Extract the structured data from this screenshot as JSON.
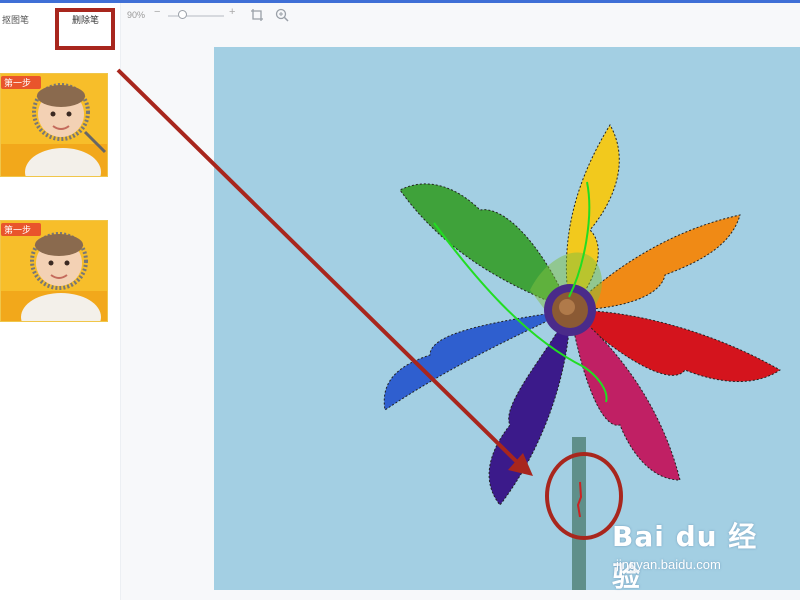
{
  "toolbar": {
    "tabs": [
      {
        "label": "抠图笔"
      },
      {
        "label": "删除笔"
      }
    ],
    "zoom_level": "90%",
    "zoom_minus": "−",
    "zoom_plus": "+",
    "zoom_fraction": 0.25
  },
  "steps": [
    {
      "badge": "第一步"
    },
    {
      "badge": "第一步"
    }
  ],
  "watermark": {
    "brand": "Bai du 经验",
    "url": "jingyan.baidu.com"
  },
  "colors": {
    "accent": "#3f6fd6",
    "annotation": "#a8261d",
    "canvas_bg": "#a3cfe3",
    "keep_stroke": "#22dd22",
    "erase_stroke": "#cc2222",
    "card_bg": "#f6b91f"
  }
}
